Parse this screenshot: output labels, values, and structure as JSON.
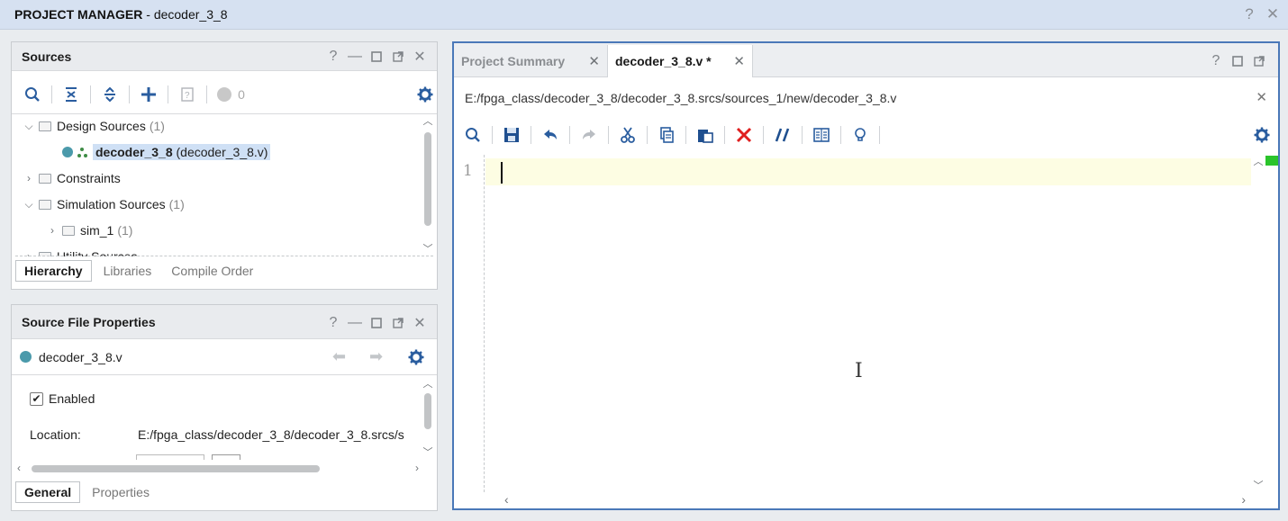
{
  "title_bar": {
    "section": "PROJECT MANAGER",
    "separator": " - ",
    "project": "decoder_3_8",
    "help": "?",
    "close": "✕"
  },
  "sources_panel": {
    "title": "Sources",
    "badge_count": "0",
    "tree": [
      {
        "label": "Design Sources",
        "count": "(1)",
        "expanded": true
      },
      {
        "label": "decoder_3_8",
        "detail": "(decoder_3_8.v)",
        "selected": true
      },
      {
        "label": "Constraints",
        "count": "",
        "expanded": false
      },
      {
        "label": "Simulation Sources",
        "count": "(1)",
        "expanded": true
      },
      {
        "label": "sim_1",
        "count": "(1)",
        "expanded": false
      },
      {
        "label": "Utility Sources",
        "count": "",
        "expanded": false
      }
    ],
    "tabs": [
      "Hierarchy",
      "Libraries",
      "Compile Order"
    ]
  },
  "props_panel": {
    "title": "Source File Properties",
    "file": "decoder_3_8.v",
    "enabled_label": "Enabled",
    "location_label": "Location:",
    "location_value": "E:/fpga_class/decoder_3_8/decoder_3_8.srcs/s",
    "tabs": [
      "General",
      "Properties"
    ]
  },
  "editor": {
    "tabs": [
      {
        "label": "Project Summary",
        "active": false
      },
      {
        "label": "decoder_3_8.v *",
        "active": true
      }
    ],
    "path": "E:/fpga_class/decoder_3_8/decoder_3_8.srcs/sources_1/new/decoder_3_8.v",
    "line_number": "1"
  },
  "colors": {
    "accent": "#4a78b8",
    "status_dot": "#4b9aab",
    "error_x": "#e02020",
    "marker": "#2bc42b"
  }
}
